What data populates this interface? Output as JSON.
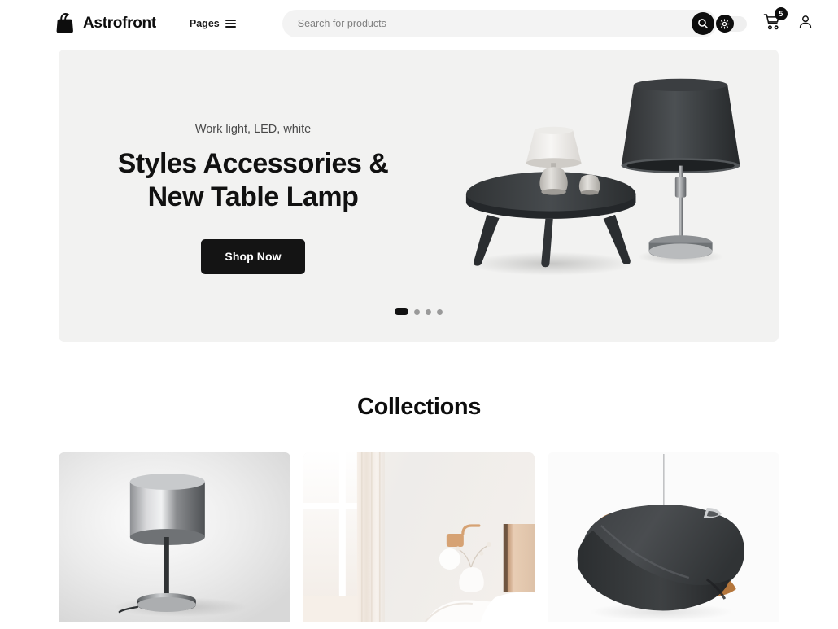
{
  "header": {
    "brand": {
      "name": "Astrofront",
      "icon": "shopping-bag-icon"
    },
    "nav": {
      "pages_label": "Pages",
      "menu_icon": "hamburger-icon"
    },
    "search": {
      "placeholder": "Search for products",
      "value": "",
      "button_icon": "search-icon"
    },
    "actions": {
      "theme_toggle_icon": "sun-icon",
      "theme_toggle_state": "dark",
      "cart_icon": "cart-icon",
      "cart_count": "5",
      "account_icon": "user-icon"
    }
  },
  "hero": {
    "eyebrow": "Work light, LED, white",
    "title_line1": "Styles Accessories &",
    "title_line2": "New Table Lamp",
    "cta_label": "Shop Now",
    "image_alt": "round dark coffee table with white table lamp, vases and tall floor lamp",
    "carousel": {
      "total": 4,
      "active_index": 0
    }
  },
  "collections": {
    "title": "Collections",
    "cards": [
      {
        "name": "collection-card-table-lamp",
        "alt": "silver chrome table lamp on grey gradient background"
      },
      {
        "name": "collection-card-bedroom",
        "alt": "bright white bedroom with window, copper wall lamp and vase"
      },
      {
        "name": "collection-card-pendant-lamp",
        "alt": "dark sculptural pendant lamp with copper interior"
      }
    ]
  },
  "colors": {
    "accent": "#0d0d0d",
    "page_bg": "#ffffff",
    "hero_bg": "#f2f2f1",
    "search_bg": "#f3f3f3",
    "muted_text": "#808080"
  }
}
